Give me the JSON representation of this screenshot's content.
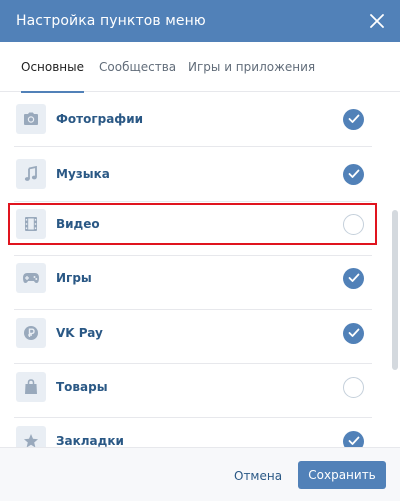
{
  "header": {
    "title": "Настройка пунктов меню",
    "close_icon": "close-icon"
  },
  "tabs": [
    {
      "label": "Основные",
      "active": true
    },
    {
      "label": "Сообщества",
      "active": false
    },
    {
      "label": "Игры и приложения",
      "active": false
    }
  ],
  "items": [
    {
      "label": "Фотографии",
      "icon": "camera-icon",
      "checked": true
    },
    {
      "label": "Музыка",
      "icon": "music-note-icon",
      "checked": true
    },
    {
      "label": "Видео",
      "icon": "film-icon",
      "checked": false,
      "highlighted": true
    },
    {
      "label": "Игры",
      "icon": "gamepad-icon",
      "checked": true
    },
    {
      "label": "VK Pay",
      "icon": "vkpay-icon",
      "checked": true
    },
    {
      "label": "Товары",
      "icon": "shopping-bag-icon",
      "checked": false
    },
    {
      "label": "Закладки",
      "icon": "star-icon",
      "checked": true
    }
  ],
  "footer": {
    "cancel_label": "Отмена",
    "save_label": "Сохранить"
  },
  "colors": {
    "header_bg": "#5181b8",
    "accent": "#5181b8",
    "link": "#2a5885",
    "highlight_border": "#e0141e",
    "icon_bg": "#e9eef4",
    "icon_fg": "#99a9bc"
  }
}
